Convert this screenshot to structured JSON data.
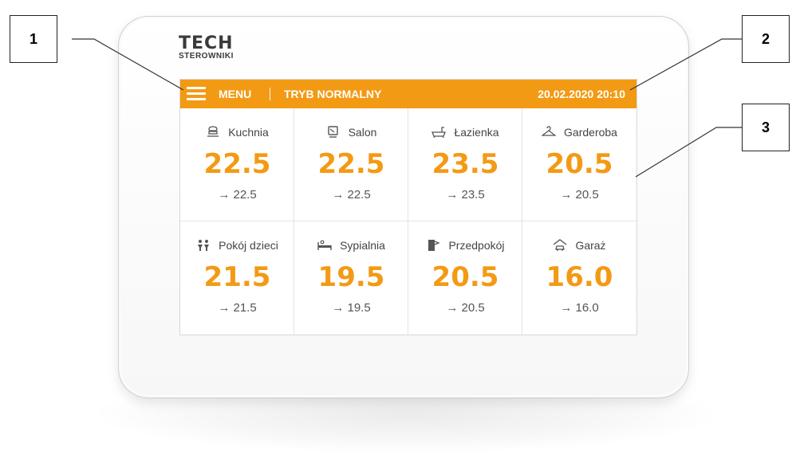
{
  "device": {
    "brand": "TECH",
    "brand_sub": "STEROWNIKI"
  },
  "topbar": {
    "menu_label": "MENU",
    "mode_label": "TRYB NORMALNY",
    "datetime": "20.02.2020 20:10",
    "accent_color": "#f39a14"
  },
  "zones": [
    {
      "name": "Kuchnia",
      "icon": "kitchen-icon",
      "temp": "22.5",
      "set": "→ 22.5"
    },
    {
      "name": "Salon",
      "icon": "tv-icon",
      "temp": "22.5",
      "set": "→ 22.5"
    },
    {
      "name": "Łazienka",
      "icon": "bathtub-icon",
      "temp": "23.5",
      "set": "→ 23.5"
    },
    {
      "name": "Garderoba",
      "icon": "hanger-icon",
      "temp": "20.5",
      "set": "→ 20.5"
    },
    {
      "name": "Pokój dzieci",
      "icon": "children-icon",
      "temp": "21.5",
      "set": "→ 21.5"
    },
    {
      "name": "Sypialnia",
      "icon": "bed-icon",
      "temp": "19.5",
      "set": "→ 19.5"
    },
    {
      "name": "Przedpokój",
      "icon": "door-icon",
      "temp": "20.5",
      "set": "→ 20.5"
    },
    {
      "name": "Garaż",
      "icon": "garage-icon",
      "temp": "16.0",
      "set": "→ 16.0"
    }
  ],
  "callouts": [
    "1",
    "2",
    "3"
  ]
}
